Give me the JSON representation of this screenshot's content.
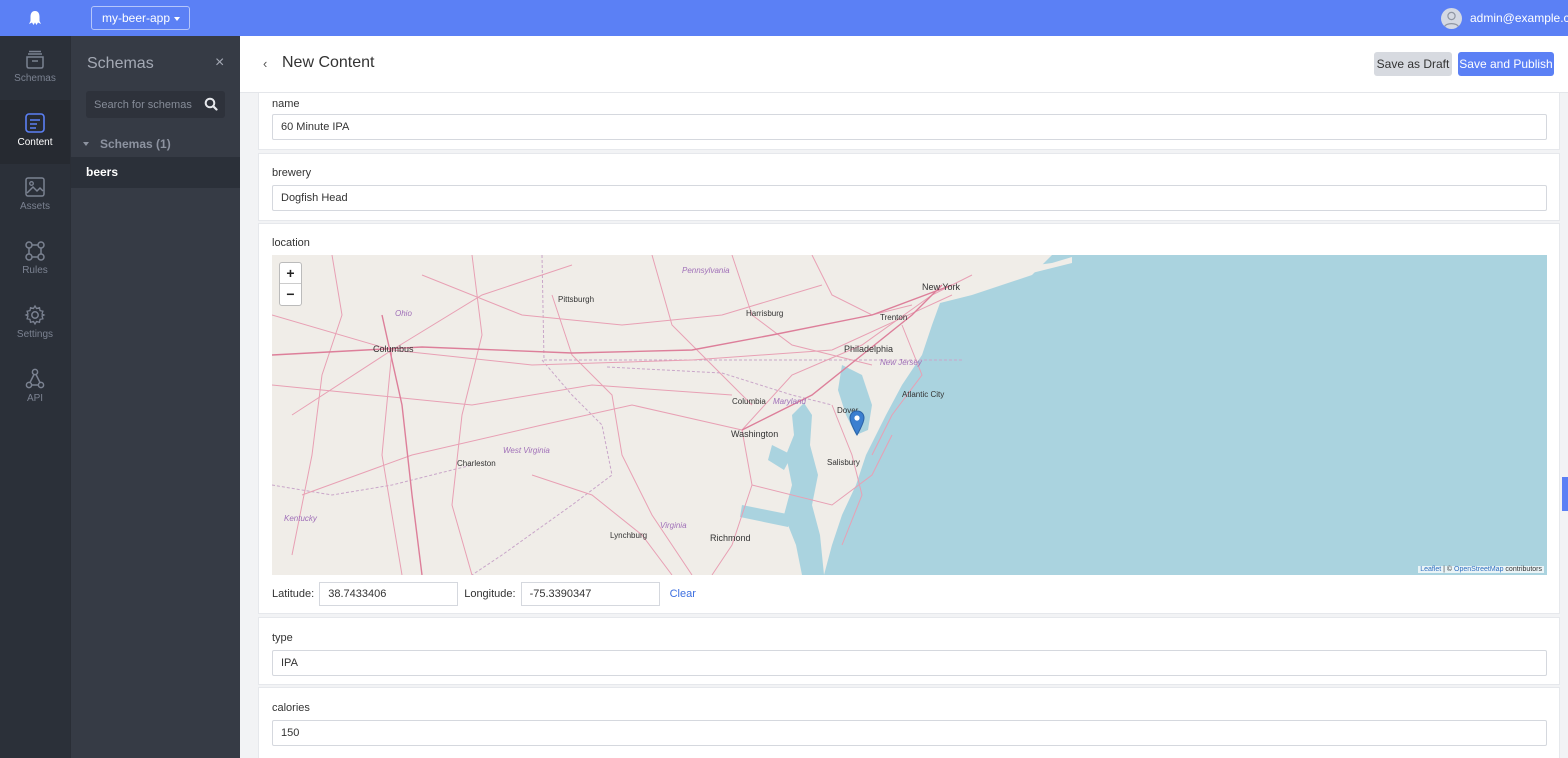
{
  "topbar": {
    "app_name": "my-beer-app",
    "user_email": "admin@example.com"
  },
  "rail": {
    "items": [
      {
        "label": "Schemas",
        "icon": "schemas-icon"
      },
      {
        "label": "Content",
        "icon": "content-icon"
      },
      {
        "label": "Assets",
        "icon": "assets-icon"
      },
      {
        "label": "Rules",
        "icon": "rules-icon"
      },
      {
        "label": "Settings",
        "icon": "settings-icon"
      },
      {
        "label": "API",
        "icon": "api-icon"
      }
    ],
    "active": "Content"
  },
  "panel": {
    "title": "Schemas",
    "close": "×",
    "search_placeholder": "Search for schemas",
    "group_label": "Schemas (1)",
    "items": [
      "beers"
    ]
  },
  "header": {
    "back": "‹",
    "title": "New Content",
    "save_draft_label": "Save as Draft",
    "save_publish_label": "Save and Publish"
  },
  "fields": {
    "name": {
      "label": "name",
      "value": "60 Minute IPA"
    },
    "brewery": {
      "label": "brewery",
      "value": "Dogfish Head"
    },
    "location": {
      "label": "location",
      "latitude_label": "Latitude:",
      "latitude": "38.7433406",
      "longitude_label": "Longitude:",
      "longitude": "-75.3390347",
      "clear_label": "Clear",
      "zoom_in": "+",
      "zoom_out": "−",
      "attribution_leaflet": "Leaflet",
      "attribution_sep": "| ©",
      "attribution_osm": "OpenStreetMap",
      "attribution_tail": "contributors",
      "map_labels": {
        "new_york": "New York",
        "philadelphia": "Philadelphia",
        "washington": "Washington",
        "columbus": "Columbus",
        "richmond": "Richmond",
        "pittsburgh": "Pittsburgh",
        "harrisburg": "Harrisburg",
        "baltimore": "Columbia",
        "trenton": "Trenton",
        "atlantic_city": "Atlantic City",
        "dover": "Dover",
        "salisbury": "Salisbury",
        "charleston": "Charleston",
        "lynchburg": "Lynchburg",
        "west_virginia": "West Virginia",
        "virginia": "Virginia",
        "maryland": "Maryland",
        "new_jersey": "New Jersey",
        "pennsylvania": "Pennsylvania",
        "ohio": "Ohio",
        "kentucky": "Kentucky"
      }
    },
    "type": {
      "label": "type",
      "value": "IPA"
    },
    "calories": {
      "label": "calories",
      "value": "150"
    }
  },
  "colors": {
    "brand": "#5b80f5",
    "rail_bg": "#2b3039",
    "panel_bg": "#363b45",
    "water": "#aad3df",
    "land": "#f0ede8",
    "roads": "#e8a0b4"
  }
}
